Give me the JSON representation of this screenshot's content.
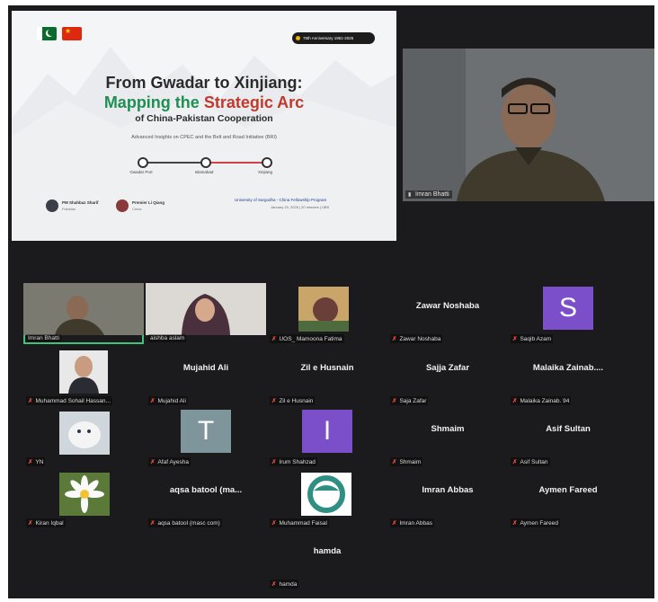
{
  "slide": {
    "badge": "75th Anniversary 1951-2026",
    "title_line1": "From Gwadar to Xinjiang:",
    "title_line2_a": "Mapping the ",
    "title_line2_b": "Strategic Arc",
    "title_line3": "of China-Pakistan Cooperation",
    "subtitle": "Advanced Insights on CPEC and the Belt and Road Initiative (BRI)",
    "timeline": [
      "Gwadar Port",
      "Islamabad",
      "Xinjiang"
    ],
    "speakers": [
      {
        "name": "PM Shahbaz Sharif",
        "role": "Pakistan"
      },
      {
        "name": "Premier Li Qiang",
        "role": "China"
      }
    ],
    "org": "University of Sargodha - China Fellowship Program",
    "org_date": "January 20, 2026  |  20 minutes | UBS"
  },
  "speaker_video": {
    "name": "Imran Bhatti"
  },
  "participants": [
    {
      "label": "Imran Bhatti",
      "display": "",
      "type": "video"
    },
    {
      "label": "aishba aslam",
      "display": "",
      "type": "video"
    },
    {
      "label": "UOS_ Mamoona Fatima",
      "display": "",
      "type": "photo",
      "muted": true
    },
    {
      "label": "Zawar Noshaba",
      "display": "Zawar Noshaba",
      "type": "name",
      "muted": true
    },
    {
      "label": "Saqib Azam",
      "display": "S",
      "type": "letter",
      "color": "#7a4fc9",
      "muted": true
    },
    {
      "label": "Muhammad Sohail Hassan...",
      "display": "",
      "type": "photo",
      "muted": true
    },
    {
      "label": "Mujahid Ali",
      "display": "Mujahid Ali",
      "type": "name",
      "muted": true
    },
    {
      "label": "Zil e Husnain",
      "display": "Zil e Husnain",
      "type": "name",
      "muted": true
    },
    {
      "label": "Saja Zafar",
      "display": "Sajja Zafar",
      "type": "name",
      "muted": true
    },
    {
      "label": "Malaika Zainab. 94",
      "display": "Malaika  Zainab....",
      "type": "name",
      "muted": true
    },
    {
      "label": "YN",
      "display": "",
      "type": "photo",
      "muted": true
    },
    {
      "label": "Afaf Ayesha",
      "display": "T",
      "type": "letter",
      "color": "#7f959c",
      "muted": true
    },
    {
      "label": "Irum Shahzad",
      "display": "I",
      "type": "letter",
      "color": "#7a4fc9",
      "muted": true
    },
    {
      "label": "Shmaim",
      "display": "Shmaim",
      "type": "name",
      "muted": true
    },
    {
      "label": "Asif Sultan",
      "display": "Asif Sultan",
      "type": "name",
      "muted": true
    },
    {
      "label": "Kiran Iqbal",
      "display": "",
      "type": "photo",
      "muted": true
    },
    {
      "label": "aqsa batool (masc com)",
      "display": "aqsa batool (ma...",
      "type": "name",
      "muted": true
    },
    {
      "label": "Muhammad Faisal",
      "display": "",
      "type": "photo",
      "muted": true
    },
    {
      "label": "Imran Abbas",
      "display": "Imran Abbas",
      "type": "name",
      "muted": true
    },
    {
      "label": "Aymen Fareed",
      "display": "Aymen Fareed",
      "type": "name",
      "muted": true
    },
    {
      "label": "hamda",
      "display": "hamda",
      "type": "name",
      "muted": true
    }
  ],
  "colors": {
    "background": "#1b1b1d",
    "speaking_border": "#3fc47a",
    "mic_muted": "#e74c3c"
  }
}
